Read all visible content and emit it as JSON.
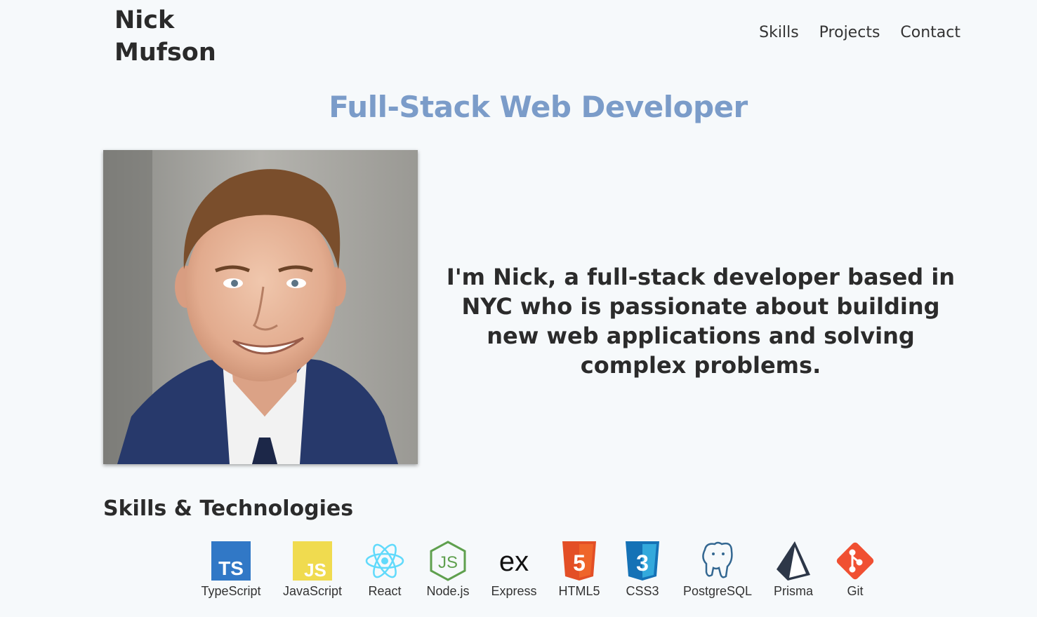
{
  "header": {
    "brand": "Nick Mufson",
    "nav": [
      "Skills",
      "Projects",
      "Contact"
    ]
  },
  "hero": {
    "headline": "Full-Stack Web Developer",
    "bio": "I'm Nick, a full-stack developer based in NYC who is passionate about building new web applications and solving complex problems."
  },
  "skills": {
    "heading": "Skills & Technologies",
    "items": [
      {
        "label": "TypeScript",
        "icon": "typescript-icon"
      },
      {
        "label": "JavaScript",
        "icon": "javascript-icon"
      },
      {
        "label": "React",
        "icon": "react-icon"
      },
      {
        "label": "Node.js",
        "icon": "nodejs-icon"
      },
      {
        "label": "Express",
        "icon": "express-icon"
      },
      {
        "label": "HTML5",
        "icon": "html5-icon"
      },
      {
        "label": "CSS3",
        "icon": "css3-icon"
      },
      {
        "label": "PostgreSQL",
        "icon": "postgresql-icon"
      },
      {
        "label": "Prisma",
        "icon": "prisma-icon"
      },
      {
        "label": "Git",
        "icon": "git-icon"
      }
    ]
  },
  "colors": {
    "background": "#f6f9fb",
    "headline": "#7b9cc9",
    "text": "#2a2a2a"
  }
}
